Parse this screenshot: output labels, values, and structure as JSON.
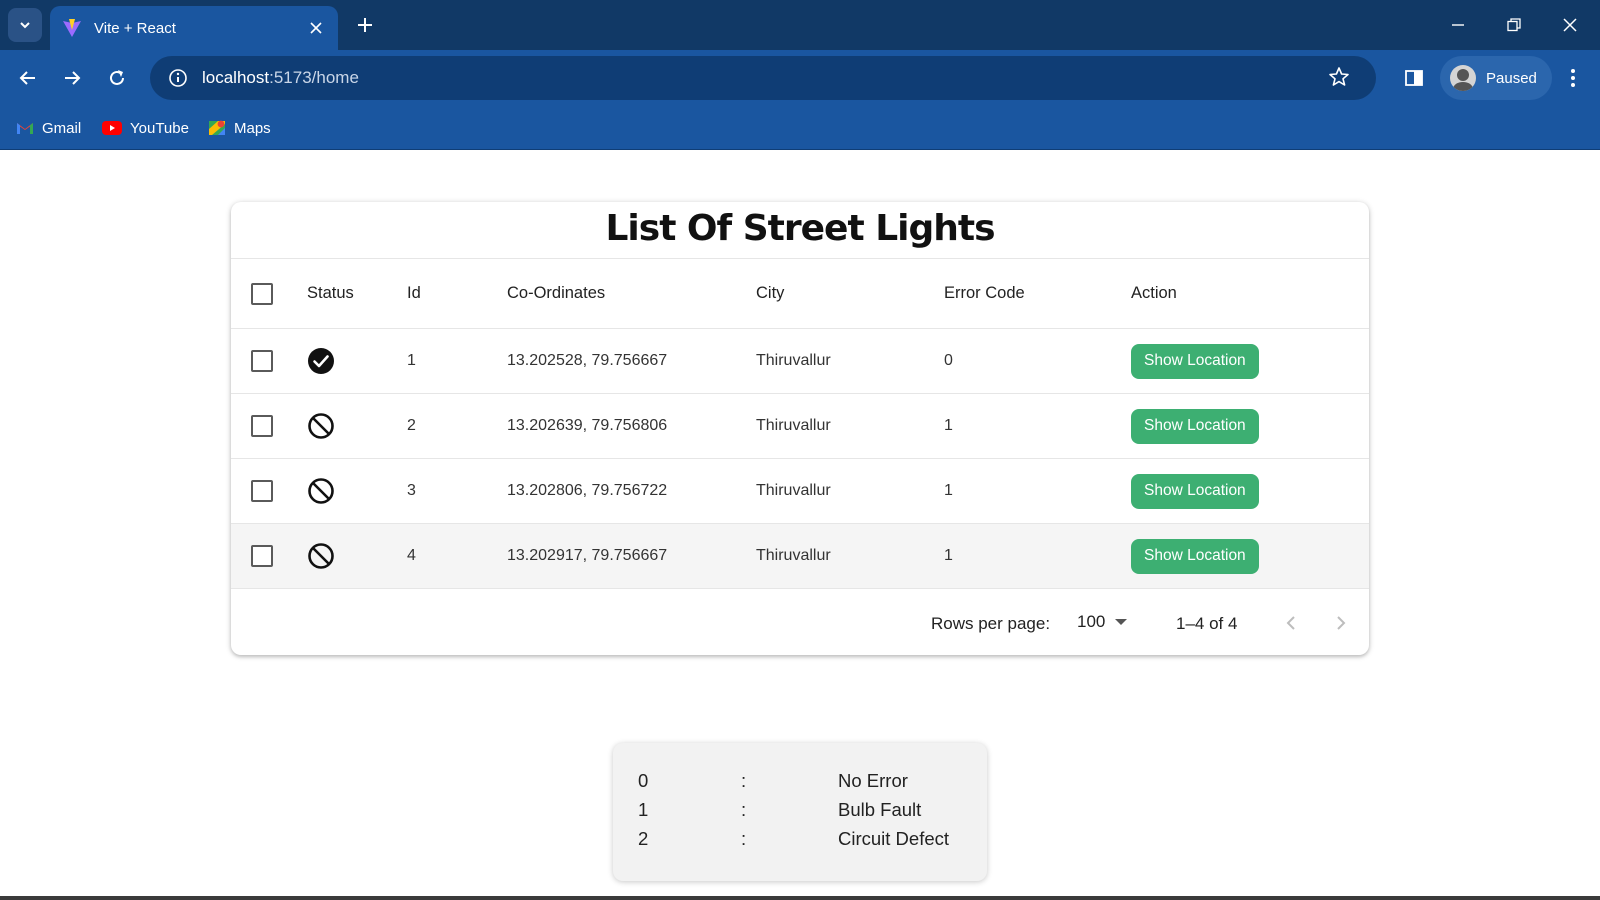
{
  "browser": {
    "tab_title": "Vite + React",
    "url_host": "localhost",
    "url_rest": ":5173/home",
    "profile_label": "Paused",
    "bookmarks": [
      {
        "label": "Gmail",
        "icon": "gmail-icon"
      },
      {
        "label": "YouTube",
        "icon": "youtube-icon"
      },
      {
        "label": "Maps",
        "icon": "maps-icon"
      }
    ],
    "colors": {
      "titlebar": "#113966",
      "toolbar": "#1a56a0",
      "omnibox": "#0f3d75"
    }
  },
  "page": {
    "title": "List Of Street Lights",
    "columns": {
      "status": "Status",
      "id": "Id",
      "coordinates": "Co-Ordinates",
      "city": "City",
      "error_code": "Error Code",
      "action": "Action"
    },
    "rows": [
      {
        "status": "ok",
        "status_icon": "check-circle-icon",
        "id": "1",
        "coordinates": "13.202528, 79.756667",
        "city": "Thiruvallur",
        "error_code": "0",
        "action": "Show Location"
      },
      {
        "status": "fault",
        "status_icon": "block-icon",
        "id": "2",
        "coordinates": "13.202639, 79.756806",
        "city": "Thiruvallur",
        "error_code": "1",
        "action": "Show Location"
      },
      {
        "status": "fault",
        "status_icon": "block-icon",
        "id": "3",
        "coordinates": "13.202806, 79.756722",
        "city": "Thiruvallur",
        "error_code": "1",
        "action": "Show Location"
      },
      {
        "status": "fault",
        "status_icon": "block-icon",
        "id": "4",
        "coordinates": "13.202917, 79.756667",
        "city": "Thiruvallur",
        "error_code": "1",
        "action": "Show Location"
      }
    ],
    "footer": {
      "rows_per_page_label": "Rows per page:",
      "rows_per_page_value": "100",
      "range_text": "1–4 of 4"
    },
    "button_color": "#3daf72"
  },
  "legend": [
    {
      "code": "0",
      "sep": ":",
      "desc": "No Error"
    },
    {
      "code": "1",
      "sep": ":",
      "desc": "Bulb Fault"
    },
    {
      "code": "2",
      "sep": ":",
      "desc": "Circuit Defect"
    }
  ]
}
